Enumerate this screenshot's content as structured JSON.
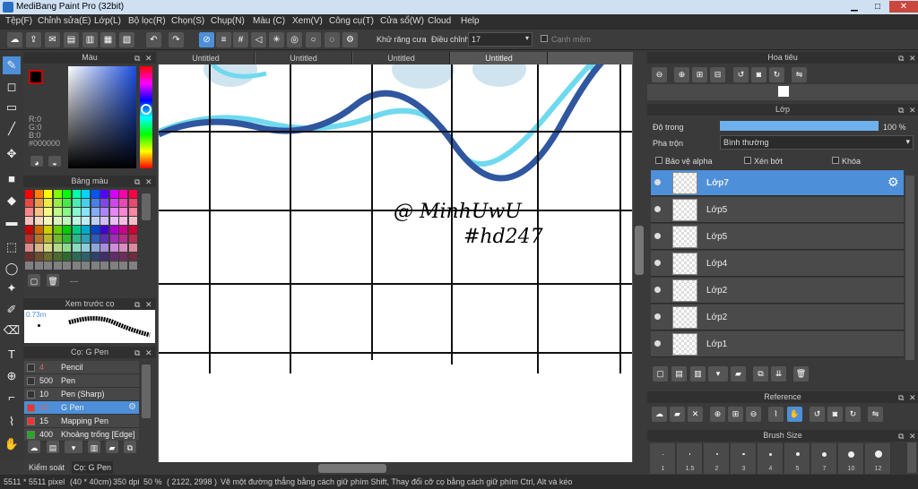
{
  "app": {
    "title": "MediBang Paint Pro (32bit)"
  },
  "menu": [
    "Tệp(F)",
    "Chỉnh sửa(E)",
    "Lớp(L)",
    "Bộ lọc(R)",
    "Chọn(S)",
    "Chụp(N)",
    "Màu (C)",
    "Xem(V)",
    "Công cụ(T)",
    "Cửa sổ(W)",
    "Cloud",
    "Help"
  ],
  "toolbar": {
    "antialias_label": "Khử răng cưa",
    "correction_label": "Điều chỉnh",
    "correction_value": "17",
    "edge_label": "Cạnh mềm"
  },
  "tabs": [
    "Untitled",
    "Untitled",
    "Untitled",
    "Untitled"
  ],
  "color_panel": {
    "title": "Màu",
    "r": "R:0",
    "g": "G:0",
    "b": "B:0",
    "hex": "#000000"
  },
  "palette_panel": {
    "title": "Bảng màu",
    "more": "---"
  },
  "preview_panel": {
    "title": "Xem trước cọ",
    "size": "0.73m"
  },
  "brush_panel": {
    "title": "Cọ: G Pen",
    "brushes": [
      {
        "size": "4",
        "name": "Pencil",
        "color": "#e06060"
      },
      {
        "size": "500",
        "name": "Pen",
        "color": "#eeeeee"
      },
      {
        "size": "10",
        "name": "Pen (Sharp)",
        "color": "#eeeeee"
      },
      {
        "size": "10",
        "name": "G Pen",
        "color": "#e06060"
      },
      {
        "size": "15",
        "name": "Mapping Pen",
        "color": "#eeeeee"
      },
      {
        "size": "400",
        "name": "Khoảng trống [Edge]",
        "color": "#eeeeee"
      }
    ]
  },
  "bottom_tabs": [
    "Kiểm soát cọ",
    "Cọ: G Pen"
  ],
  "navigator": {
    "title": "Hoa tiêu"
  },
  "layer_panel": {
    "title": "Lớp",
    "opacity_label": "Độ trong",
    "opacity_value": "100 %",
    "opacity_fraction": 1.0,
    "blend_label": "Pha trộn",
    "blend_value": "Bình thường",
    "protect_alpha": "Bảo vệ alpha",
    "clipping": "Xén bớt",
    "lock": "Khóa",
    "layers": [
      "Lớp7",
      "Lớp5",
      "Lớp5",
      "Lớp4",
      "Lớp2",
      "Lớp2",
      "Lớp1"
    ]
  },
  "reference_panel": {
    "title": "Reference"
  },
  "brush_size_panel": {
    "title": "Brush Size",
    "sizes": [
      "1",
      "1.5",
      "2",
      "3",
      "4",
      "5",
      "7",
      "10",
      "12"
    ]
  },
  "canvas": {
    "text_line1": "@ MinhUwU",
    "text_line2": "#hd247"
  },
  "status": {
    "dims": "5511 * 5511 pixel",
    "cm": "(40 * 40cm)",
    "dpi": "350 dpi",
    "zoom": "50 %",
    "coords": "( 2122, 2998 )",
    "hint": "Vẽ một đường thẳng bằng cách giữ phím Shift, Thay đổi cỡ cọ bằng cách giữ phím Ctrl, Alt và kéo"
  }
}
